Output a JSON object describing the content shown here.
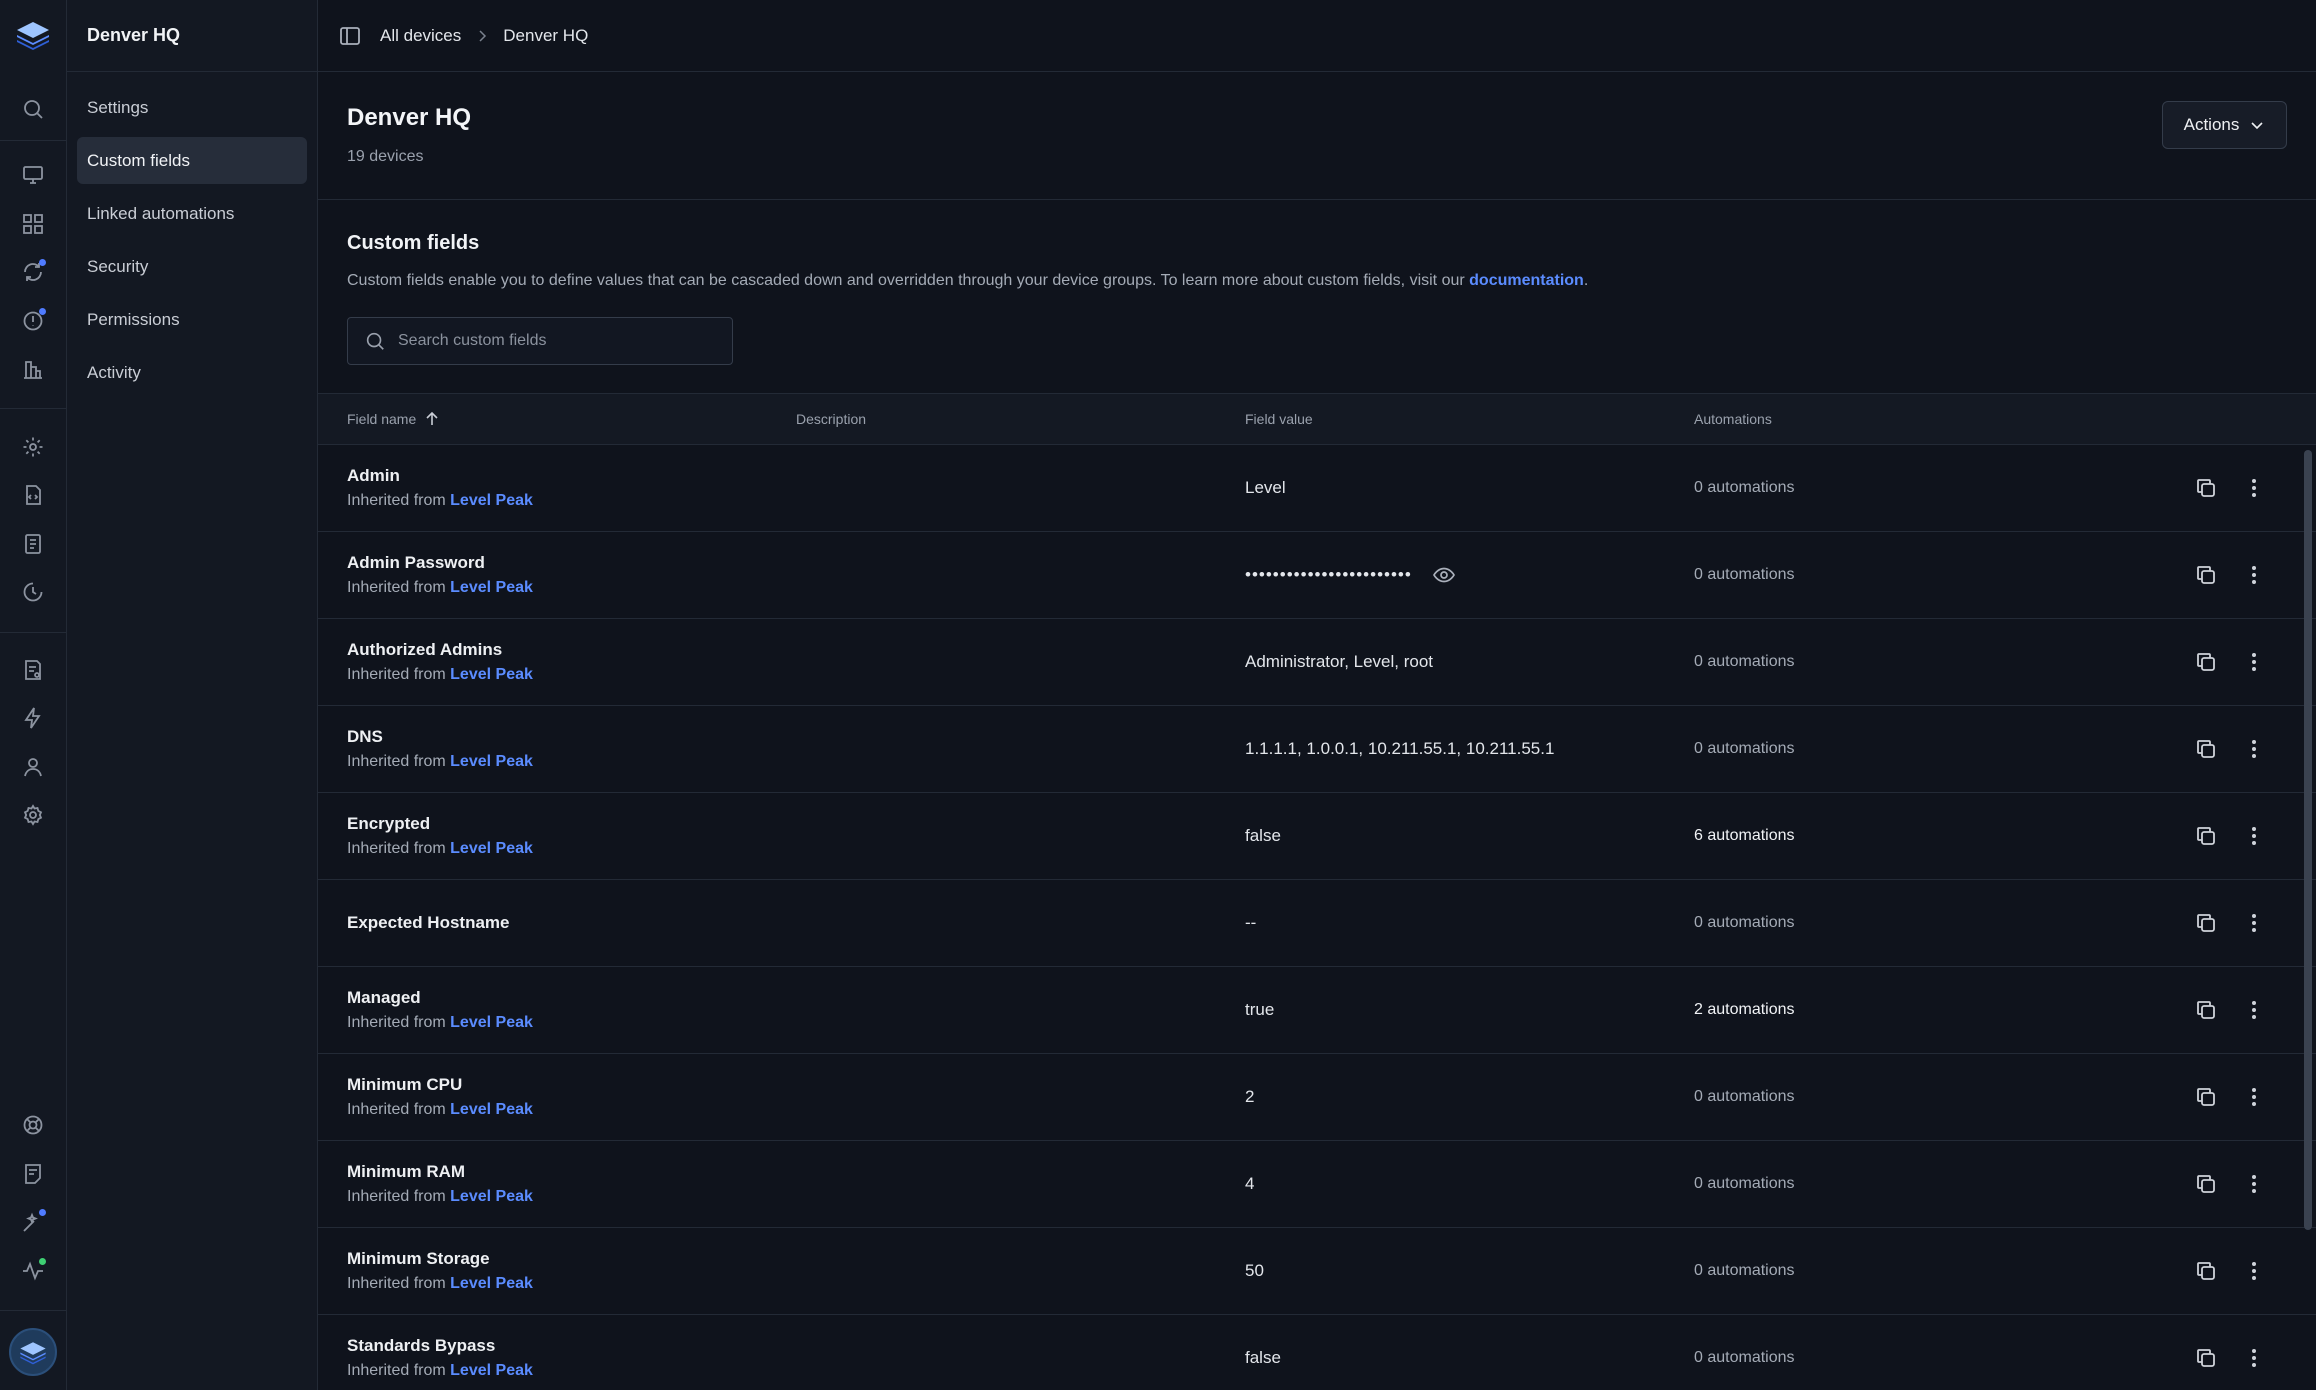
{
  "breadcrumb": {
    "root": "All devices",
    "current": "Denver HQ"
  },
  "sidebar": {
    "title": "Denver HQ",
    "items": [
      {
        "label": "Settings",
        "active": false
      },
      {
        "label": "Custom fields",
        "active": true
      },
      {
        "label": "Linked automations",
        "active": false
      },
      {
        "label": "Security",
        "active": false
      },
      {
        "label": "Permissions",
        "active": false
      },
      {
        "label": "Activity",
        "active": false
      }
    ]
  },
  "rail": {
    "icons": [
      "logo-icon",
      "search-icon",
      "monitor-icon",
      "grid-icon",
      "sync-icon",
      "alert-icon",
      "reports-icon",
      "settings-cog-icon",
      "script-icon",
      "document-icon",
      "history-icon",
      "checklist-icon",
      "lightning-icon",
      "user-icon",
      "gear-icon",
      "help-icon",
      "feedback-icon",
      "sparkle-icon",
      "activity-icon",
      "avatar"
    ]
  },
  "page": {
    "title": "Denver HQ",
    "subtitle": "19 devices",
    "actions_label": "Actions"
  },
  "section": {
    "title": "Custom fields",
    "desc_before": "Custom fields enable you to define values that can be cascaded down and overridden through your device groups. To learn more about custom fields, visit our ",
    "desc_link": "documentation",
    "desc_after": ".",
    "search_placeholder": "Search custom fields"
  },
  "table": {
    "columns": [
      "Field name",
      "Description",
      "Field value",
      "Automations"
    ],
    "sort": {
      "column": "Field name",
      "direction": "ascending"
    },
    "inherited_prefix": "Inherited from ",
    "rows": [
      {
        "name": "Admin",
        "inherited_from": "Level Peak",
        "description": "",
        "value": "Level",
        "automations": "0 automations"
      },
      {
        "name": "Admin Password",
        "inherited_from": "Level Peak",
        "description": "",
        "value": "••••••••••••••••••••••••",
        "masked": true,
        "automations": "0 automations"
      },
      {
        "name": "Authorized Admins",
        "inherited_from": "Level Peak",
        "description": "",
        "value": "Administrator, Level, root",
        "automations": "0 automations"
      },
      {
        "name": "DNS",
        "inherited_from": "Level Peak",
        "description": "",
        "value": "1.1.1.1, 1.0.0.1, 10.211.55.1, 10.211.55.1",
        "automations": "0 automations"
      },
      {
        "name": "Encrypted",
        "inherited_from": "Level Peak",
        "description": "",
        "value": "false",
        "automations": "6 automations"
      },
      {
        "name": "Expected Hostname",
        "inherited_from": "",
        "description": "",
        "value": "--",
        "automations": "0 automations"
      },
      {
        "name": "Managed",
        "inherited_from": "Level Peak",
        "description": "",
        "value": "true",
        "automations": "2 automations"
      },
      {
        "name": "Minimum CPU",
        "inherited_from": "Level Peak",
        "description": "",
        "value": "2",
        "automations": "0 automations"
      },
      {
        "name": "Minimum RAM",
        "inherited_from": "Level Peak",
        "description": "",
        "value": "4",
        "automations": "0 automations"
      },
      {
        "name": "Minimum Storage",
        "inherited_from": "Level Peak",
        "description": "",
        "value": "50",
        "automations": "0 automations"
      },
      {
        "name": "Standards Bypass",
        "inherited_from": "Level Peak",
        "description": "",
        "value": "false",
        "automations": "0 automations"
      }
    ]
  },
  "colors": {
    "accent": "#5b8cff",
    "background": "#0f131c",
    "sidebar": "#131822",
    "notify_dot": "#4f7bff",
    "status_dot": "#3ecf73"
  }
}
